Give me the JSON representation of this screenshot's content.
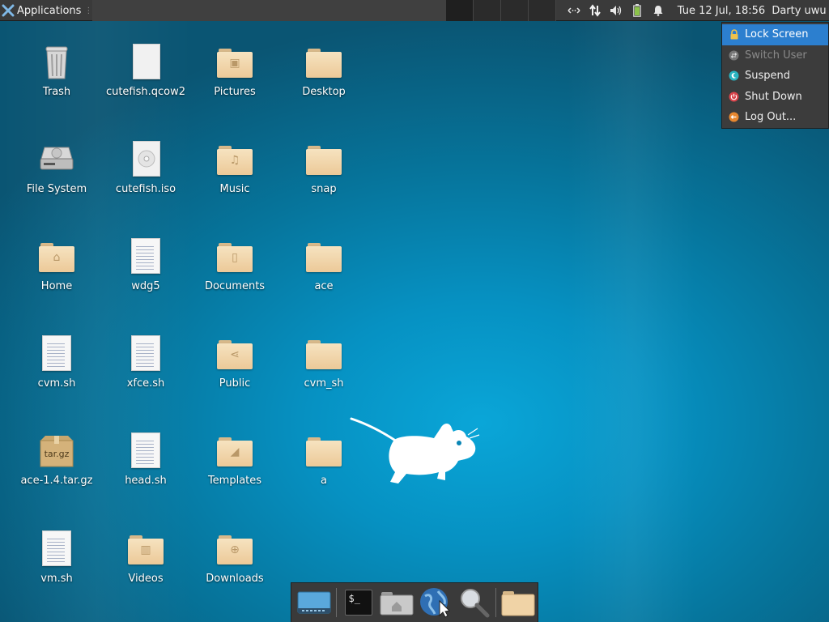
{
  "panel": {
    "applications_label": "Applications",
    "clock": "Tue 12 Jul, 18:56",
    "user": "Darty uwu"
  },
  "action_menu": {
    "items": [
      {
        "label": "Lock Screen",
        "icon": "lock-icon",
        "highlighted": true
      },
      {
        "label": "Switch User",
        "icon": "switch-user-icon",
        "disabled": true
      },
      {
        "label": "Suspend",
        "icon": "suspend-icon"
      },
      {
        "label": "Shut Down",
        "icon": "power-icon"
      },
      {
        "label": "Log Out...",
        "icon": "logout-icon"
      }
    ]
  },
  "desktop": {
    "icons": [
      {
        "label": "Trash",
        "icon": "trash-icon"
      },
      {
        "label": "cutefish.qcow2",
        "icon": "blank-file-icon"
      },
      {
        "label": "Pictures",
        "icon": "pictures-folder-icon"
      },
      {
        "label": "Desktop",
        "icon": "folder-icon"
      },
      {
        "label": "File System",
        "icon": "drive-icon"
      },
      {
        "label": "cutefish.iso",
        "icon": "disc-image-icon"
      },
      {
        "label": "Music",
        "icon": "music-folder-icon"
      },
      {
        "label": "snap",
        "icon": "folder-icon"
      },
      {
        "label": "Home",
        "icon": "home-folder-icon"
      },
      {
        "label": "wdg5",
        "icon": "text-file-icon"
      },
      {
        "label": "Documents",
        "icon": "documents-folder-icon"
      },
      {
        "label": "ace",
        "icon": "folder-icon"
      },
      {
        "label": "cvm.sh",
        "icon": "text-file-icon"
      },
      {
        "label": "xfce.sh",
        "icon": "text-file-icon"
      },
      {
        "label": "Public",
        "icon": "public-folder-icon"
      },
      {
        "label": "cvm_sh",
        "icon": "folder-icon"
      },
      {
        "label": "ace-1.4.tar.gz",
        "icon": "archive-icon",
        "badge": "tar.gz"
      },
      {
        "label": "head.sh",
        "icon": "text-file-icon"
      },
      {
        "label": "Templates",
        "icon": "templates-folder-icon"
      },
      {
        "label": "a",
        "icon": "folder-icon"
      },
      {
        "label": "vm.sh",
        "icon": "text-file-icon"
      },
      {
        "label": "Videos",
        "icon": "videos-folder-icon"
      },
      {
        "label": "Downloads",
        "icon": "downloads-folder-icon"
      }
    ]
  },
  "dock": {
    "items": [
      "show-desktop-icon",
      "terminal-icon",
      "home-folder-icon",
      "web-browser-icon",
      "search-icon",
      "folder-icon"
    ],
    "terminal_glyph": "$_"
  },
  "colors": {
    "panel_bg": "#3a3a3a",
    "menu_highlight": "#2c7fcf",
    "folder": "#f0d3a6",
    "desktop_bg": "#0691c2"
  }
}
